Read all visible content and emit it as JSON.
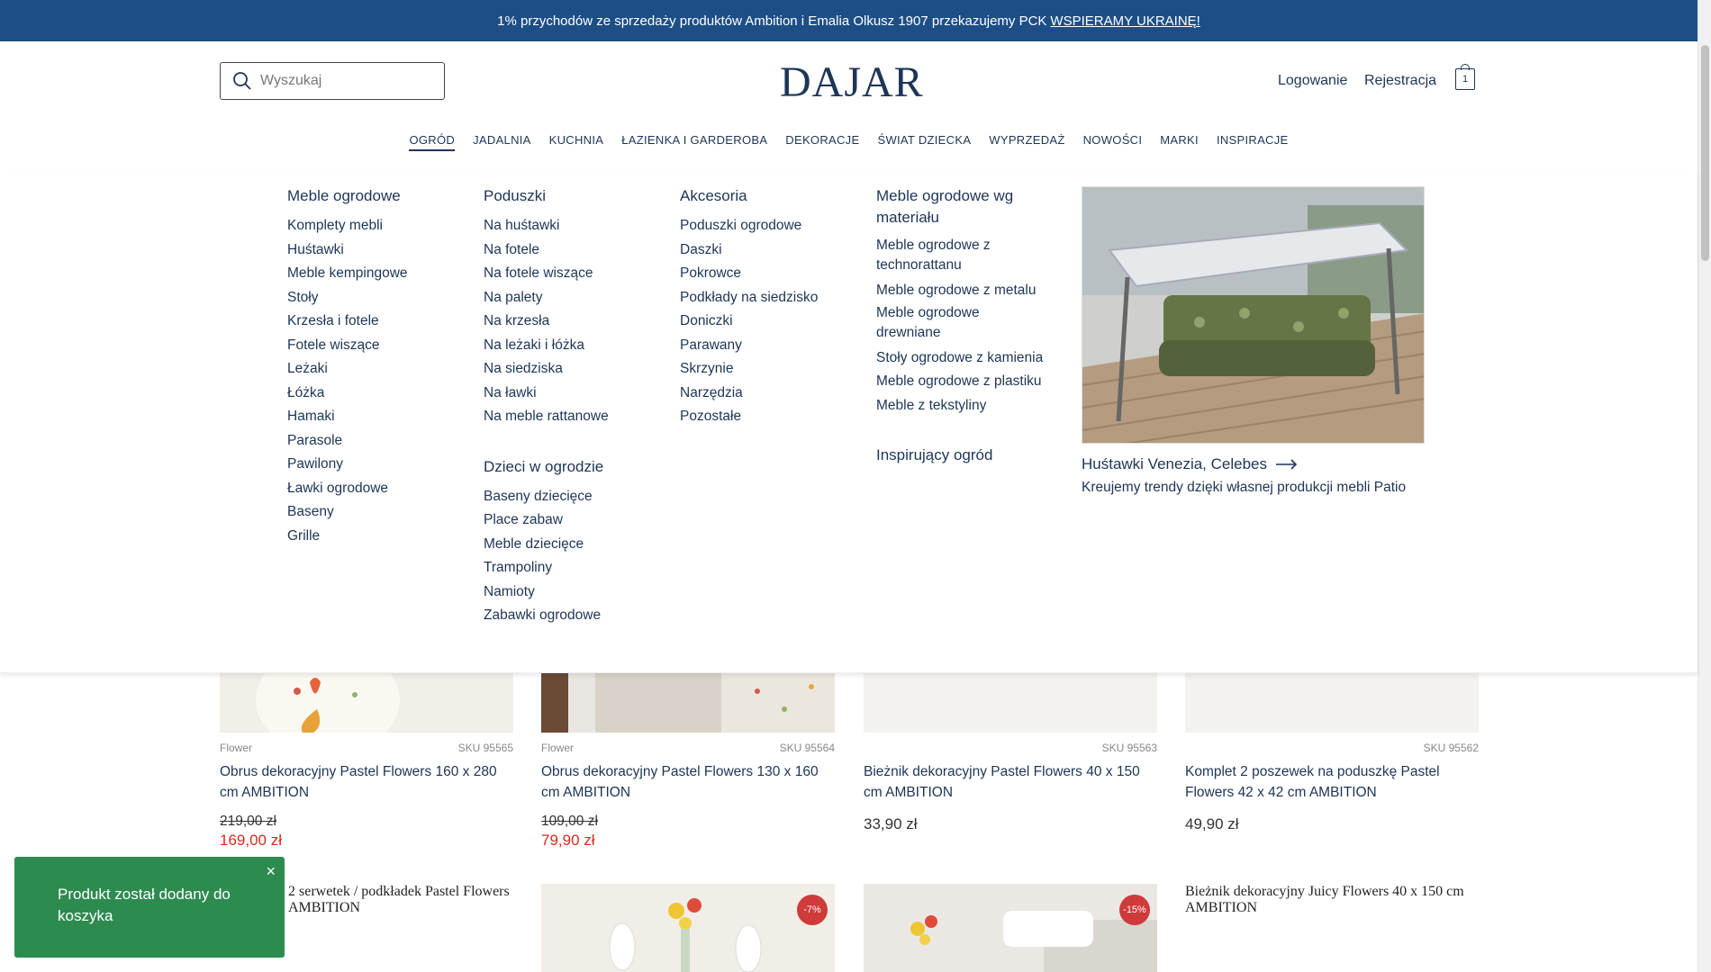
{
  "promo_banner": {
    "text": "1% przychodów ze sprzedaży produktów Ambition i Emalia Olkusz 1907 przekazujemy PCK",
    "link": "WSPIERAMY UKRAINĘ!"
  },
  "header": {
    "search_placeholder": "Wyszukaj",
    "logo": "DAJAR",
    "login": "Logowanie",
    "register": "Rejestracja",
    "cart_count": "1"
  },
  "nav": [
    "OGRÓD",
    "JADALNIA",
    "KUCHNIA",
    "ŁAZIENKA I GARDEROBA",
    "DEKORACJE",
    "ŚWIAT DZIECKA",
    "WYPRZEDAŻ",
    "NOWOŚCI",
    "MARKI",
    "INSPIRACJE"
  ],
  "mega_menu": {
    "col1": {
      "title": "Meble ogrodowe",
      "items": [
        "Komplety mebli",
        "Huśtawki",
        "Meble kempingowe",
        "Stoły",
        "Krzesła i fotele",
        "Fotele wiszące",
        "Leżaki",
        "Łóżka",
        "Hamaki",
        "Parasole",
        "Pawilony",
        "Ławki ogrodowe",
        "Baseny",
        "Grille"
      ]
    },
    "col2": {
      "title": "Poduszki",
      "items": [
        "Na huśtawki",
        "Na fotele",
        "Na fotele wiszące",
        "Na palety",
        "Na krzesła",
        "Na leżaki i łóżka",
        "Na siedziska",
        "Na ławki",
        "Na meble rattanowe"
      ],
      "title2": "Dzieci w ogrodzie",
      "items2": [
        "Baseny dziecięce",
        "Place zabaw",
        "Meble dziecięce",
        "Trampoliny",
        "Namioty",
        "Zabawki ogrodowe"
      ]
    },
    "col3": {
      "title": "Akcesoria",
      "items": [
        "Poduszki ogrodowe",
        "Daszki",
        "Pokrowce",
        "Podkłady na siedzisko",
        "Doniczki",
        "Parawany",
        "Skrzynie",
        "Narzędzia",
        "Pozostałe"
      ]
    },
    "col4": {
      "title": "Meble ogrodowe wg materiału",
      "items": [
        "Meble ogrodowe z technorattanu",
        "Meble ogrodowe z metalu",
        "Meble ogrodowe drewniane",
        "Stoły ogrodowe z kamienia",
        "Meble ogrodowe z plastiku",
        "Meble z tekstyliny"
      ],
      "title2": "Inspirujący ogród"
    },
    "feature": {
      "title": "Huśtawki Venezia, Celebes",
      "subtitle": "Kreujemy trendy dzięki własnej produkcji mebli Patio"
    }
  },
  "products": [
    {
      "brand": "Flower",
      "sku": "SKU 95565",
      "name": "Obrus dekoracyjny Pastel Flowers 160 x 280 cm AMBITION",
      "old_price": "219,00 zł",
      "price": "169,00 zł"
    },
    {
      "brand": "Flower",
      "sku": "SKU 95564",
      "name": "Obrus dekoracyjny Pastel Flowers 130 x 160 cm AMBITION",
      "old_price": "109,00 zł",
      "price": "79,90 zł"
    },
    {
      "brand": "",
      "sku": "SKU 95563",
      "name": "Bieżnik dekoracyjny Pastel Flowers 40 x 150 cm AMBITION",
      "price": "33,90 zł"
    },
    {
      "brand": "",
      "sku": "SKU 95562",
      "name": "Komplet 2 poszewek na poduszkę Pastel Flowers 42 x 42 cm AMBITION",
      "price": "49,90 zł"
    }
  ],
  "row2": {
    "tile1_alt": "2 serwetek / podkładek Pastel Flowers AMBITION",
    "tile2_badge": "-7%",
    "tile3_badge": "-15%",
    "tile4_alt": "Bieżnik dekoracyjny Juicy Flowers 40 x 150 cm AMBITION"
  },
  "toast": {
    "message": "Produkt został dodany do koszyka",
    "close": "×"
  }
}
